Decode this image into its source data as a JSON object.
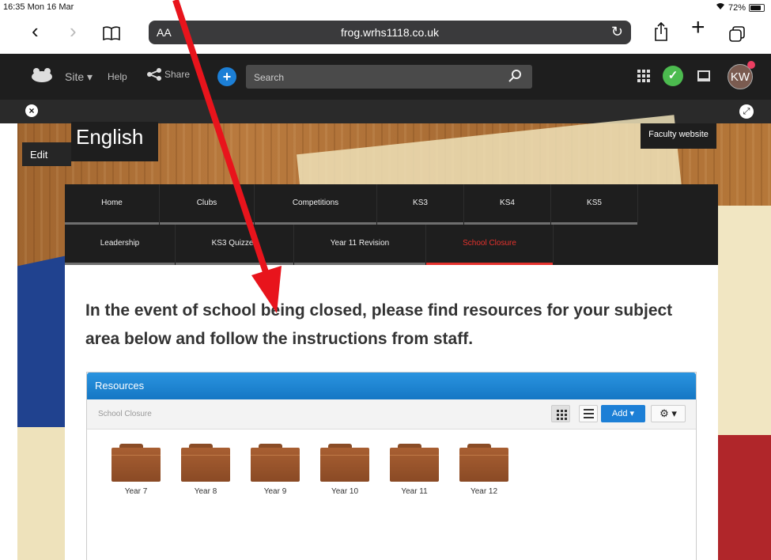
{
  "status_bar": {
    "time": "16:35  Mon 16 Mar",
    "battery": "72%"
  },
  "safari": {
    "aa": "AA",
    "url": "frog.wrhs1118.co.uk"
  },
  "frog_bar": {
    "site": "Site ▾",
    "help": "Help",
    "share": "Share",
    "search_placeholder": "Search",
    "avatar": "KW"
  },
  "page": {
    "title": "English",
    "edit": "Edit",
    "faculty_link": "Faculty website"
  },
  "nav": {
    "row1": [
      {
        "label": "Home"
      },
      {
        "label": "Clubs"
      },
      {
        "label": "Competitions"
      },
      {
        "label": "KS3"
      },
      {
        "label": "KS4"
      },
      {
        "label": "KS5"
      }
    ],
    "row2": [
      {
        "label": "Leadership"
      },
      {
        "label": "KS3 Quizzes"
      },
      {
        "label": "Year 11 Revision"
      },
      {
        "label": "School Closure",
        "active": true
      }
    ]
  },
  "content": {
    "heading": "In the event of school being closed, please find resources for your subject area below and follow the instructions from staff."
  },
  "resources": {
    "title": "Resources",
    "breadcrumb": "School Closure",
    "add_label": "Add ▾",
    "gear_label": "⚙ ▾",
    "folders": [
      {
        "label": "Year 7"
      },
      {
        "label": "Year 8"
      },
      {
        "label": "Year 9"
      },
      {
        "label": "Year 10"
      },
      {
        "label": "Year 11"
      },
      {
        "label": "Year 12"
      }
    ]
  },
  "colors": {
    "accent": "#1c7fd6",
    "active_nav": "#e5322d",
    "annotation_arrow": "#e8141c"
  }
}
